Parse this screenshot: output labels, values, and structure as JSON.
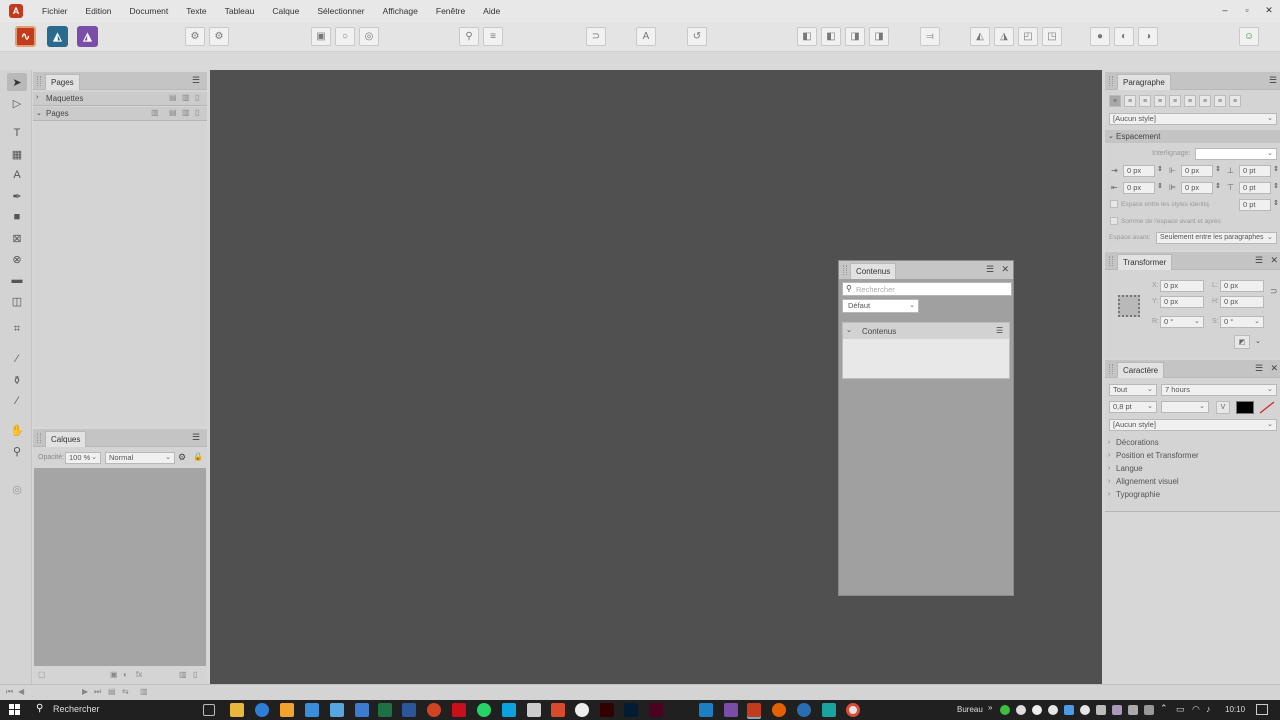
{
  "menubar": {
    "items": [
      "Fichier",
      "Edition",
      "Document",
      "Texte",
      "Tableau",
      "Calque",
      "Sélectionner",
      "Affichage",
      "Fenêtre",
      "Aide"
    ],
    "window_controls": {
      "minimize": "–",
      "maximize": "▫",
      "close": "✕"
    }
  },
  "pages_panel": {
    "tab": "Pages",
    "rows": [
      {
        "label": "Maquettes"
      },
      {
        "label": "Pages"
      }
    ]
  },
  "layers_panel": {
    "tab": "Calques",
    "opacity_label": "Opacité:",
    "opacity_value": "100 %",
    "blend_mode": "Normal"
  },
  "contents_panel": {
    "tab": "Contenus",
    "search_placeholder": "Rechercher",
    "dropdown_value": "Défaut",
    "section_title": "Contenus"
  },
  "paragraph_panel": {
    "tab": "Paragraphe",
    "style_value": "[Aucun style]",
    "spacing_title": "Espacement",
    "leading_label": "Interlignage:",
    "fields": {
      "left_indent": "0 px",
      "first_line": "0 px",
      "space_before": "0 pt",
      "right_indent": "0 px",
      "last_line": "0 px",
      "space_after": "0 pt",
      "same_style_spacing": "0 pt"
    },
    "checkbox_same_style": "Espace entre les styles identiq.",
    "checkbox_sum": "Somme de l'espace avant et après",
    "space_before_label": "Espace avant:",
    "space_before_value": "Seulement entre les paragraphes"
  },
  "transform_panel": {
    "tab": "Transformer",
    "x_label": "X:",
    "x_value": "0 px",
    "y_label": "Y:",
    "y_value": "0 px",
    "l_label": "L:",
    "l_value": "0 px",
    "h_label": "H:",
    "h_value": "0 px",
    "r_label": "R:",
    "r_value": "0 °",
    "s_label": "S:",
    "s_value": "0 °"
  },
  "character_panel": {
    "tab": "Caractère",
    "scope_value": "Tout",
    "font_value": "7 hours",
    "size_value": "0,8 pt",
    "style_value": "[Aucun style]",
    "sections": [
      "Décorations",
      "Position et Transformer",
      "Langue",
      "Alignement visuel",
      "Typographie"
    ],
    "fill_color": "#000000"
  },
  "taskbar": {
    "search_placeholder": "Rechercher",
    "desktop_label": "Bureau",
    "time": "10:10"
  },
  "colors": {
    "canvas": "#505050",
    "accent_designer": "#c33a1c",
    "accent_photo": "#2b6a8f",
    "accent_publisher": "#7a4ea8"
  }
}
